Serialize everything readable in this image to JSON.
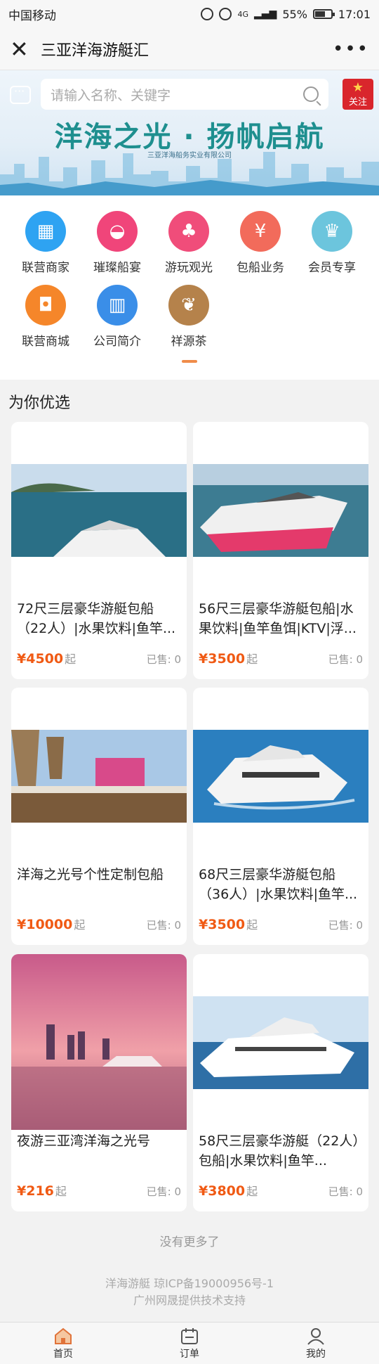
{
  "status": {
    "carrier": "中国移动",
    "battery": "55%",
    "time": "17:01",
    "network": "4G"
  },
  "nav": {
    "title": "三亚洋海游艇汇"
  },
  "banner": {
    "search_placeholder": "请输入名称、关键字",
    "follow_label": "关注",
    "title": "洋海之光 · 扬帆启航",
    "subtitle": "三亚洋海船务实业有限公司"
  },
  "categories": [
    {
      "label": "联营商家",
      "icon": "store-icon",
      "color": "#2ea3f2"
    },
    {
      "label": "璀璨船宴",
      "icon": "dining-icon",
      "color": "#f0457a"
    },
    {
      "label": "游玩观光",
      "icon": "palm-tree-icon",
      "color": "#f04d7a"
    },
    {
      "label": "包船业务",
      "icon": "yen-icon",
      "color": "#f26b5b"
    },
    {
      "label": "会员专享",
      "icon": "crown-icon",
      "color": "#6cc5dd"
    },
    {
      "label": "联营商城",
      "icon": "shopping-bag-icon",
      "color": "#f5862a"
    },
    {
      "label": "公司简介",
      "icon": "building-icon",
      "color": "#3a8ee8"
    },
    {
      "label": "祥源茶",
      "icon": "tea-leaf-icon",
      "color": "#b5824b"
    }
  ],
  "section_title": "为你优选",
  "products": [
    {
      "title": "72尺三层豪华游艇包船（22人）|水果饮料|鱼竿...",
      "price": "¥4500",
      "price_suffix": "起",
      "sold": "已售: 0"
    },
    {
      "title": "56尺三层豪华游艇包船|水果饮料|鱼竿鱼饵|KTV|浮...",
      "price": "¥3500",
      "price_suffix": "起",
      "sold": "已售: 0"
    },
    {
      "title": "洋海之光号个性定制包船",
      "price": "¥10000",
      "price_suffix": "起",
      "sold": "已售: 0"
    },
    {
      "title": "68尺三层豪华游艇包船（36人）|水果饮料|鱼竿...",
      "price": "¥3500",
      "price_suffix": "起",
      "sold": "已售: 0"
    },
    {
      "title": "夜游三亚湾洋海之光号",
      "price": "¥216",
      "price_suffix": "起",
      "sold": "已售: 0"
    },
    {
      "title": "58尺三层豪华游艇（22人）包船|水果饮料|鱼竿...",
      "price": "¥3800",
      "price_suffix": "起",
      "sold": "已售: 0"
    }
  ],
  "no_more": "没有更多了",
  "footer": {
    "icp": "洋海游艇   琼ICP备19000956号-1",
    "support": "广州网晟提供技术支持"
  },
  "tabs": [
    {
      "label": "首页",
      "icon": "home-icon"
    },
    {
      "label": "订单",
      "icon": "order-icon"
    },
    {
      "label": "我的",
      "icon": "user-icon"
    }
  ]
}
